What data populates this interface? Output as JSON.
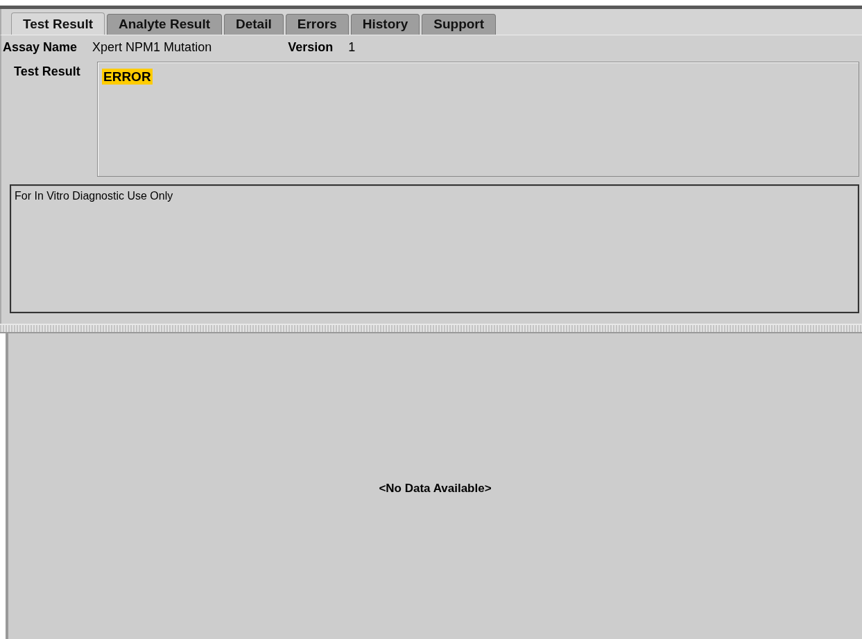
{
  "tabs": [
    {
      "label": "Test Result",
      "selected": true
    },
    {
      "label": "Analyte Result",
      "selected": false
    },
    {
      "label": "Detail",
      "selected": false
    },
    {
      "label": "Errors",
      "selected": false
    },
    {
      "label": "History",
      "selected": false
    },
    {
      "label": "Support",
      "selected": false
    }
  ],
  "assay": {
    "name_label": "Assay Name",
    "name": "Xpert NPM1 Mutation",
    "version_label": "Version",
    "version": "1"
  },
  "test_result": {
    "label": "Test Result",
    "value": "ERROR",
    "highlighted": true
  },
  "disclaimer": "For In Vitro Diagnostic Use Only",
  "lower_pane": {
    "message": "<No Data Available>"
  }
}
